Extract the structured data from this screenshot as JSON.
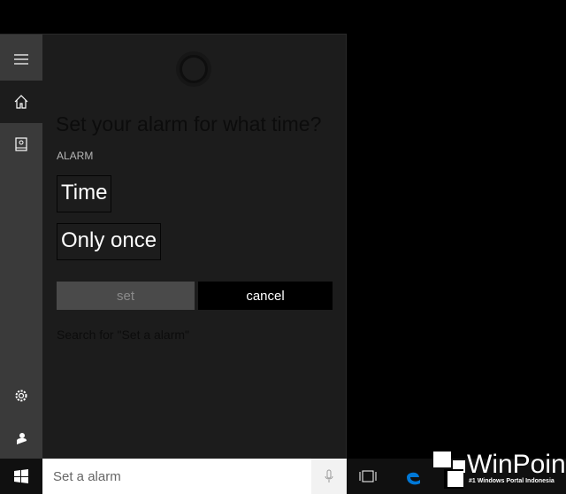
{
  "cortana": {
    "question": "Set your alarm for what time?",
    "section_label": "ALARM",
    "time_field": "Time",
    "repeat_field": "Only once",
    "set_button": "set",
    "cancel_button": "cancel",
    "web_search": "Search for \"Set a alarm\""
  },
  "sidebar": {
    "items": [
      "menu-icon",
      "home-icon",
      "notebook-icon",
      "settings-icon",
      "feedback-icon"
    ],
    "active": "home"
  },
  "taskbar": {
    "search_value": "Set a alarm"
  },
  "watermark": {
    "name": "WinPoin",
    "tagline": "#1 Windows Portal Indonesia"
  },
  "colors": {
    "edge": "#0078d7",
    "panel": "#1c1c1c",
    "sidebar": "#3a3a3a"
  }
}
